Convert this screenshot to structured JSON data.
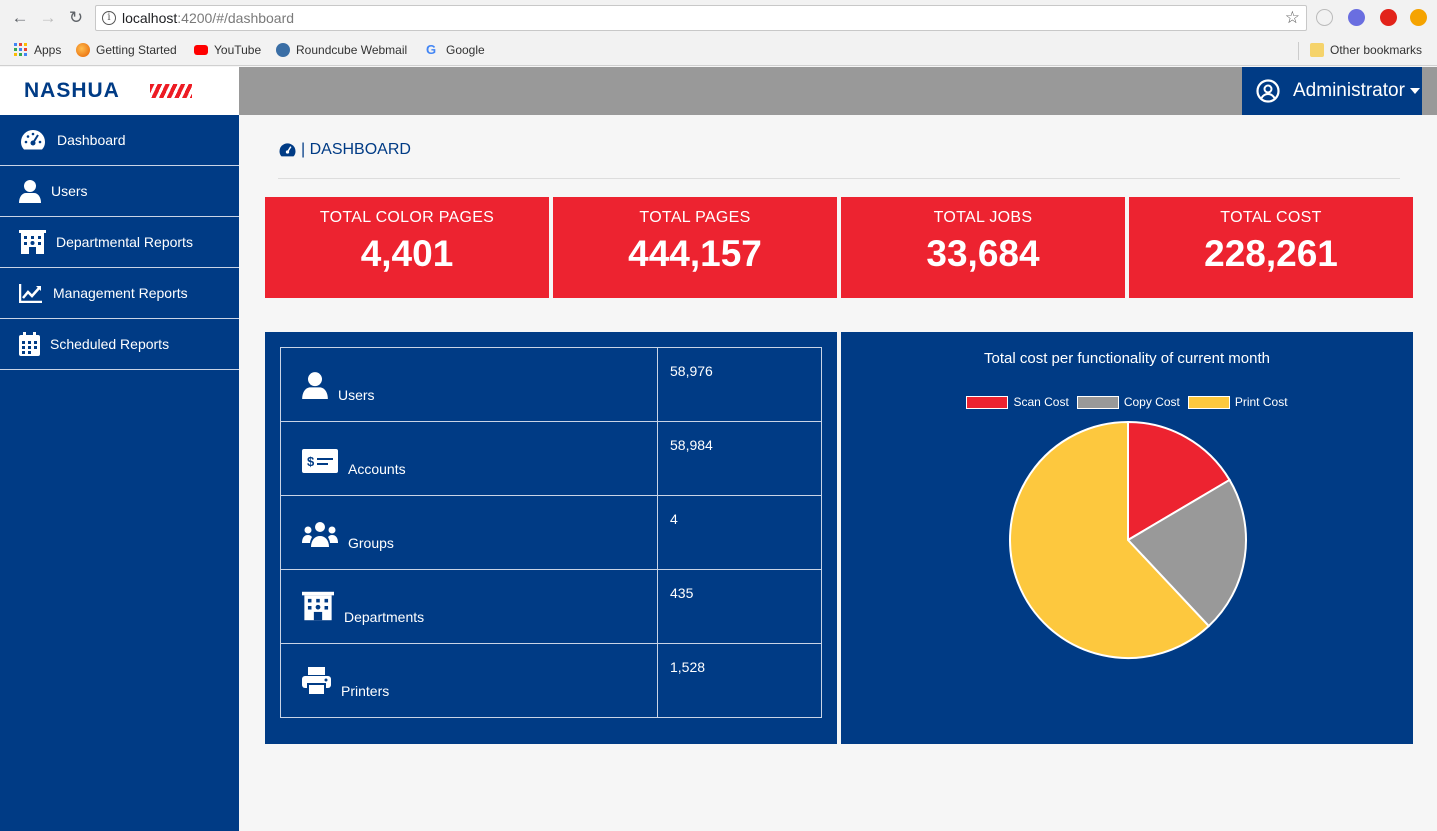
{
  "browser": {
    "url_host": "localhost",
    "url_rest": ":4200/#/dashboard",
    "bookmarks": [
      "Apps",
      "Getting Started",
      "YouTube",
      "Roundcube Webmail",
      "Google"
    ],
    "other_bookmarks": "Other bookmarks"
  },
  "app": {
    "logo": "NASHUA",
    "user": "Administrator"
  },
  "sidebar": {
    "items": [
      {
        "label": "Dashboard",
        "icon": "gauge-icon"
      },
      {
        "label": "Users",
        "icon": "user-icon"
      },
      {
        "label": "Departmental Reports",
        "icon": "building-icon"
      },
      {
        "label": "Management Reports",
        "icon": "line-chart-icon"
      },
      {
        "label": "Scheduled Reports",
        "icon": "calendar-icon"
      }
    ]
  },
  "page": {
    "breadcrumb": "| DASHBOARD"
  },
  "stats": [
    {
      "label": "TOTAL COLOR PAGES",
      "value": "4,401"
    },
    {
      "label": "TOTAL PAGES",
      "value": "444,157"
    },
    {
      "label": "TOTAL JOBS",
      "value": "33,684"
    },
    {
      "label": "TOTAL COST",
      "value": "228,261"
    }
  ],
  "summary": [
    {
      "label": "Users",
      "value": "58,976",
      "icon": "user-icon"
    },
    {
      "label": "Accounts",
      "value": "58,984",
      "icon": "money-check-icon"
    },
    {
      "label": "Groups",
      "value": "4",
      "icon": "users-group-icon"
    },
    {
      "label": "Departments",
      "value": "435",
      "icon": "building-icon"
    },
    {
      "label": "Printers",
      "value": "1,528",
      "icon": "printer-icon"
    }
  ],
  "chart_data": {
    "type": "pie",
    "title": "Total cost per functionality of current month",
    "legend_position": "top",
    "series": [
      {
        "name": "Scan Cost",
        "value": 16.5,
        "color": "#ed2330"
      },
      {
        "name": "Copy Cost",
        "value": 21.5,
        "color": "#999999"
      },
      {
        "name": "Print Cost",
        "value": 62.0,
        "color": "#fdc83e"
      }
    ]
  }
}
